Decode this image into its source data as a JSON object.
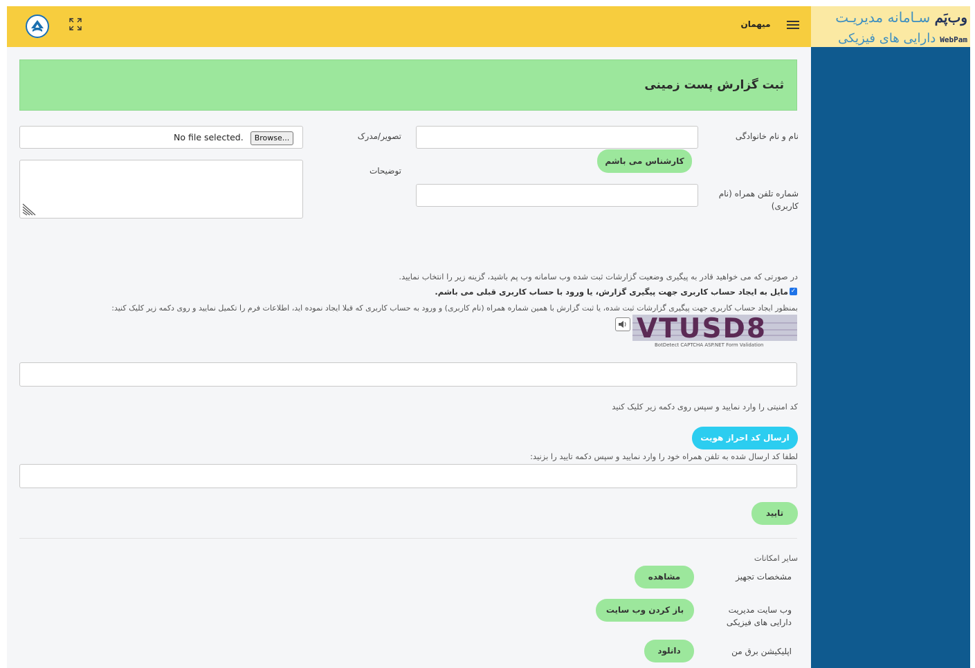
{
  "header": {
    "brand_title_a": "وب‌پَم",
    "brand_title_b": "سـامانه مدیریـت",
    "brand_sub_a": "WebPam",
    "brand_sub_b": "دارایی های فیزیکی",
    "user": "میهمان"
  },
  "page": {
    "title": "ثبت گزارش پست زمینی"
  },
  "form": {
    "name_label": "نام و نام خانوادگی",
    "image_label": "تصویر/مدرک",
    "file_button": "Browse...",
    "file_status": "No file selected.",
    "expert_button": "کارشناس می باشم",
    "description_label": "توضیحات",
    "phone_label": "شماره تلفن همراه (نام کاربری)"
  },
  "account": {
    "info_text": "در صورتی که می خواهید قادر به پیگیری وضعیت گزارشات ثبت شده وب سامانه وب پم باشید، گزینه زیر را انتخاب نمایید.",
    "checkbox_label": "مایل به ایجاد حساب کاربری جهت پیگیری گزارش، یا ورود با حساب کاربری قبلی می باشم.",
    "checkbox_checked": true,
    "instructions": "بمنظور ایجاد حساب کاربری جهت پیگیری گزارشات ثبت شده، یا ثبت گزارش با همین شماره همراه (نام کاربری) و ورود به حساب کاربری که قبلا ایجاد نموده اید، اطلاعات فرم را تکمیل نمایید و روی دکمه زیر کلیک کنید:"
  },
  "captcha": {
    "code": "VTUSD8",
    "caption": "BotDetect CAPTCHA ASP.NET Form Validation",
    "hint": "کد امنیتی را وارد نمایید و سپس روی دکمه زیر کلیک کنید"
  },
  "verify": {
    "send_button": "ارسال کد احراز هویت",
    "sms_hint": "لطفا کد ارسال شده به تلفن همراه خود را وارد نمایید و سپس دکمه تایید را بزنید:",
    "confirm_button": "تایید"
  },
  "other": {
    "heading": "سایر امکانات",
    "items": [
      {
        "label": "مشخصات تجهیز",
        "button": "مشاهده"
      },
      {
        "label": "وب سایت مدیریت دارایی های فیزیکی",
        "button": "باز کردن وب سایت"
      },
      {
        "label": "اپلیکیشن برق من",
        "button": "دانلود"
      }
    ]
  },
  "colors": {
    "header": "#f7cd3e",
    "sidebar": "#0f5a8f",
    "title_box": "#9ce79c",
    "cyan": "#2ccdf0"
  }
}
